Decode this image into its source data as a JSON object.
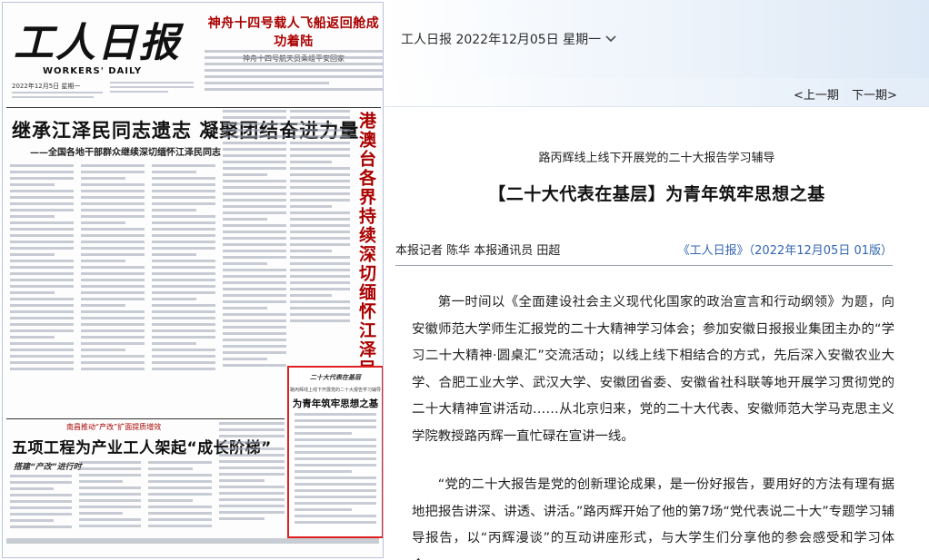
{
  "paper_page": {
    "masthead_cn": "工人日报",
    "masthead_en": "WORKERS' DAILY",
    "masthead_date": "2022年12月5日  星期一",
    "top_headline": "神舟十四号载人飞船返回舱成功着陆",
    "top_subheadline": "神舟十四号航天员乘组平安回家",
    "lead_headline": "继承江泽民同志遗志  凝聚团结奋进力量",
    "lead_subheadline": "——全国各地干部群众继续深切缅怀江泽民同志",
    "vertical_headline": "港澳台各界持续深切缅怀江泽民同志",
    "highlight_kicker": "二十大代表在基层",
    "highlight_subtitle": "路丙辉线上线下开展党的二十大报告学习辅导",
    "highlight_title": "为青年筑牢思想之基",
    "mid_subheadline": "南昌推动“产改”扩面提质增效",
    "mid_headline": "五项工程为产业工人架起“成长阶梯”",
    "mid_kicker": "搭建“产改”进行时"
  },
  "toolbar": {
    "issue_date": "工人日报 2022年12月05日 星期一",
    "prev_page": "<上一期",
    "next_page": "下一期>"
  },
  "article": {
    "kicker": "路丙辉线上线下开展党的二十大报告学习辅导",
    "title": "【二十大代表在基层】为青年筑牢思想之基",
    "byline": "本报记者 陈华 本报通讯员 田超",
    "source": "《工人日报》（2022年12月05日 01版）",
    "paragraphs": [
      "第一时间以《全面建设社会主义现代化国家的政治宣言和行动纲领》为题，向安徽师范大学师生汇报党的二十大精神学习体会；参加安徽日报报业集团主办的“学习二十大精神·圆桌汇”交流活动；以线上线下相结合的方式，先后深入安徽农业大学、合肥工业大学、武汉大学、安徽团省委、安徽省社科联等地开展学习贯彻党的二十大精神宣讲活动……从北京归来，党的二十大代表、安徽师范大学马克思主义学院教授路丙辉一直忙碌在宣讲一线。",
      "“党的二十大报告是党的创新理论成果，是一份好报告，要用好的方法有理有据地把报告讲深、讲透、讲活。”路丙辉开始了他的第7场“党代表说二十大”专题学习辅导报告，以“丙辉漫谈”的互动讲座形式，与大学生们分享他的参会感受和学习体会，"
    ]
  }
}
